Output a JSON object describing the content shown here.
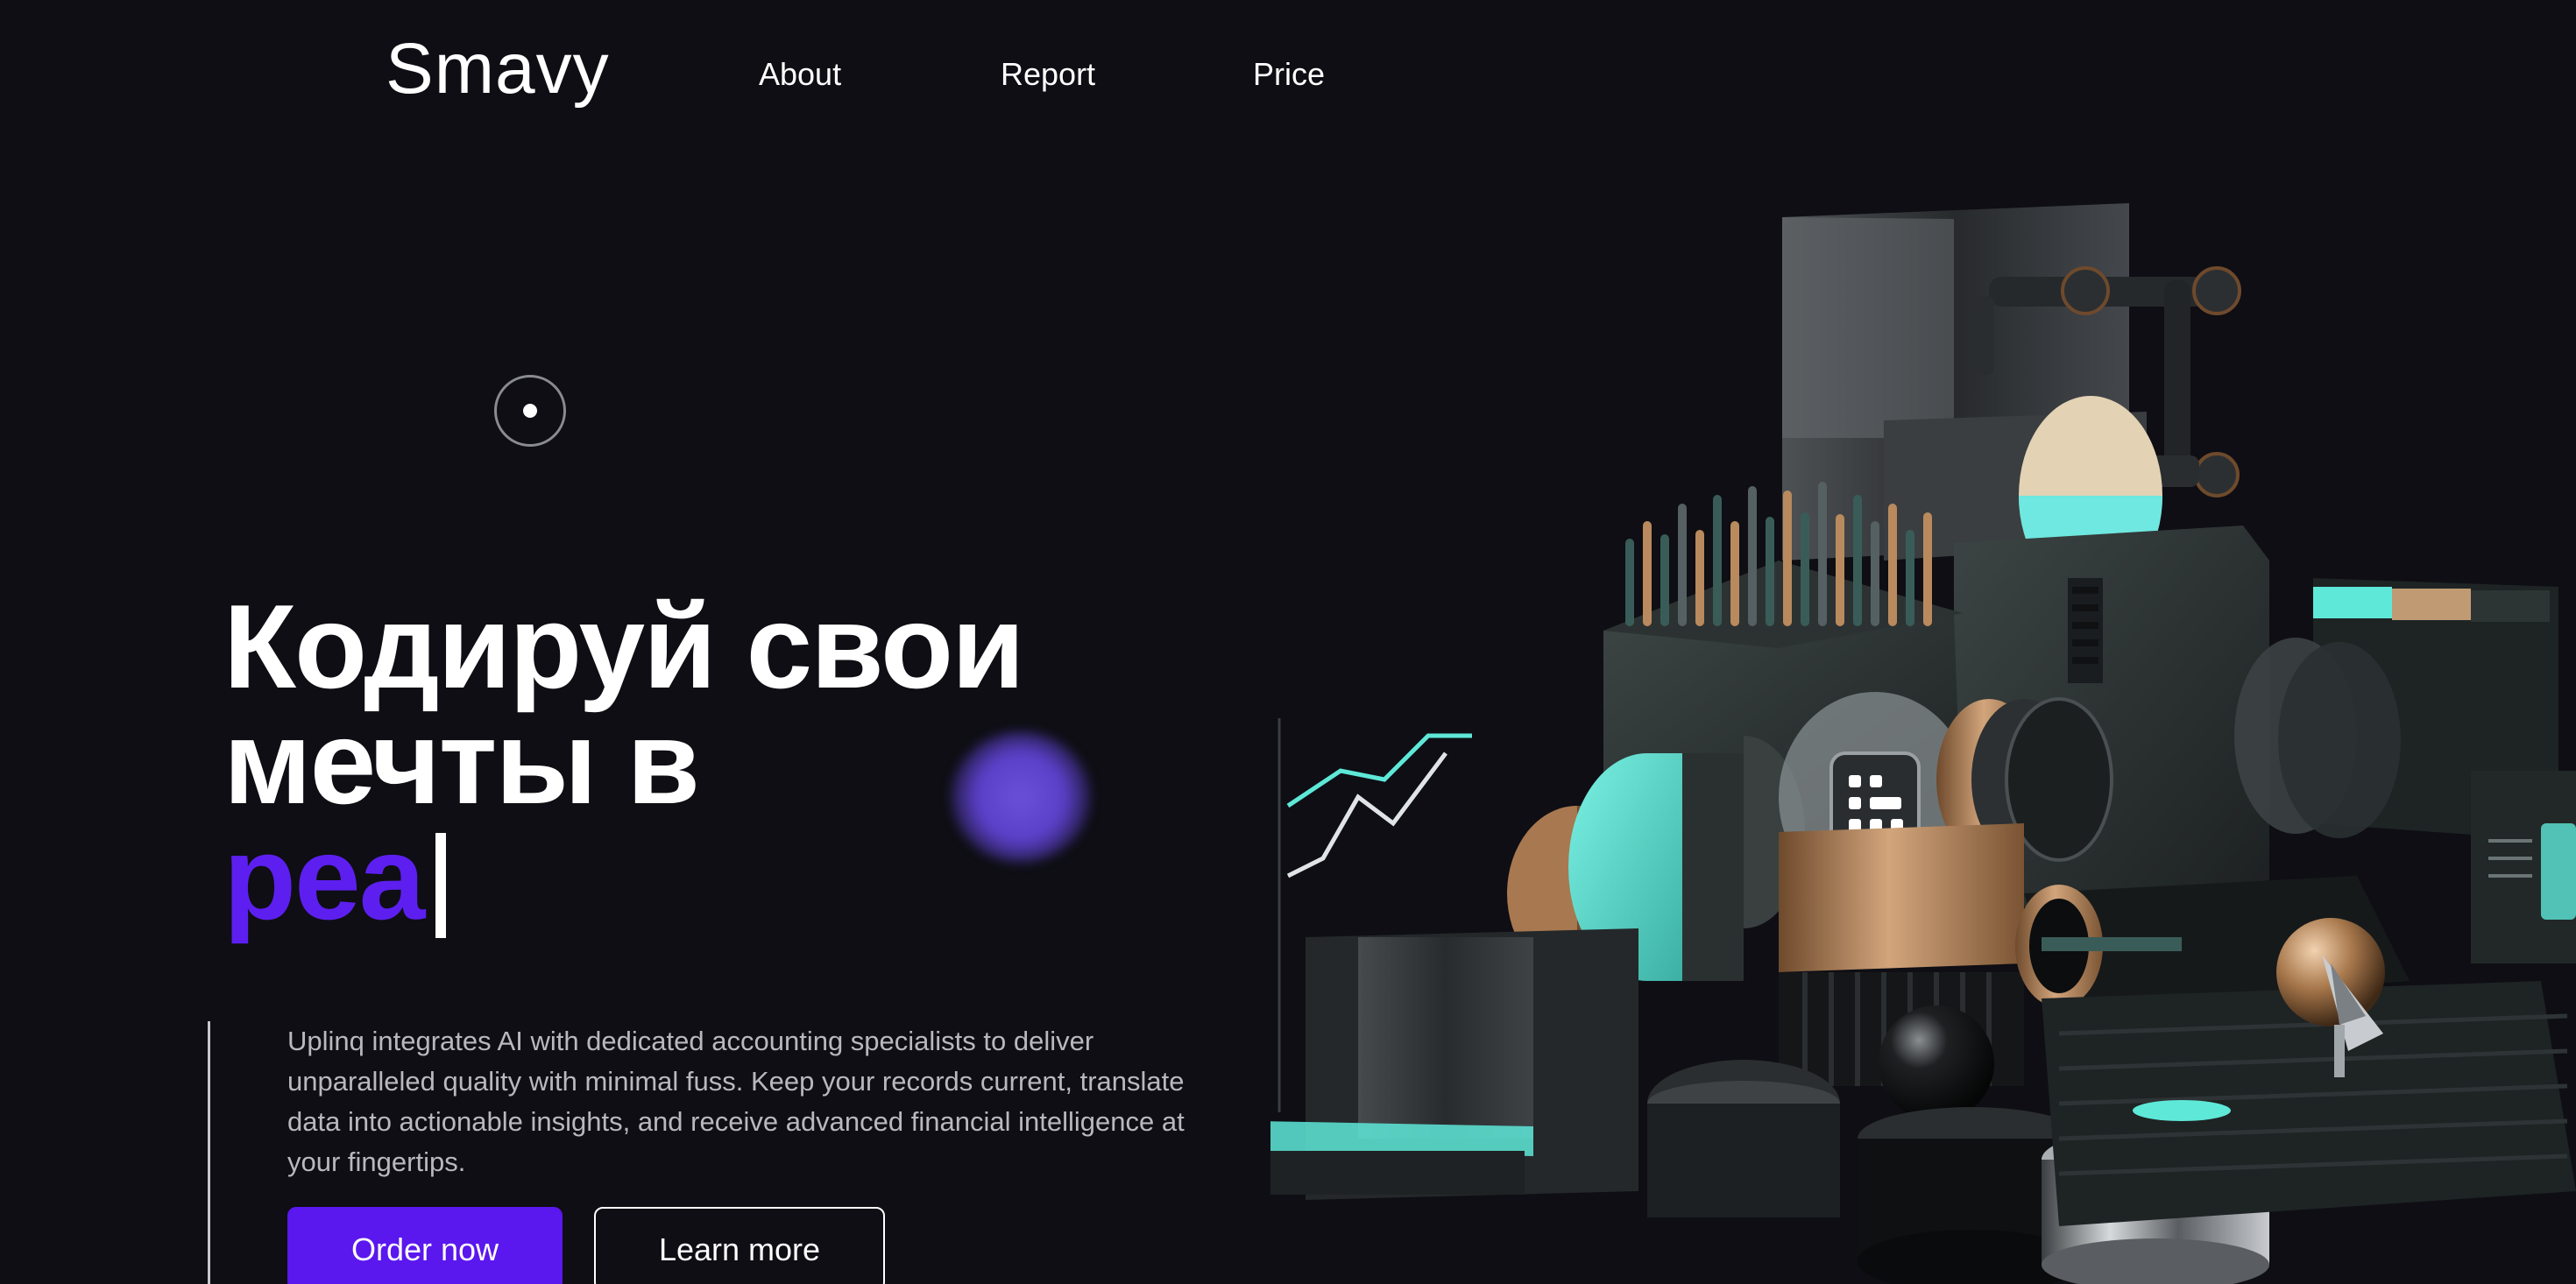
{
  "header": {
    "logo": "Smavy",
    "nav": [
      {
        "label": "About"
      },
      {
        "label": "Report"
      },
      {
        "label": "Price"
      }
    ]
  },
  "hero": {
    "headline_line1": "Кодируй свои",
    "headline_line2": "мечты в",
    "headline_typed": "реа",
    "description": "Uplinq integrates AI with dedicated accounting specialists to deliver unparalleled quality with minimal fuss. Keep your records current, translate data into actionable insights, and receive advanced financial intelligence at your fingertips.",
    "primary_button": "Order now",
    "secondary_button": "Learn more"
  },
  "colors": {
    "background": "#0e0e14",
    "accent": "#5a17ee",
    "typed_text": "#5d1ff0",
    "body_text": "#b8b8be",
    "teal": "#5ee8d8",
    "copper": "#b98a5e"
  },
  "icons": {
    "cursor": "target-cursor-icon",
    "illustration": "isometric-3d-illustration"
  }
}
